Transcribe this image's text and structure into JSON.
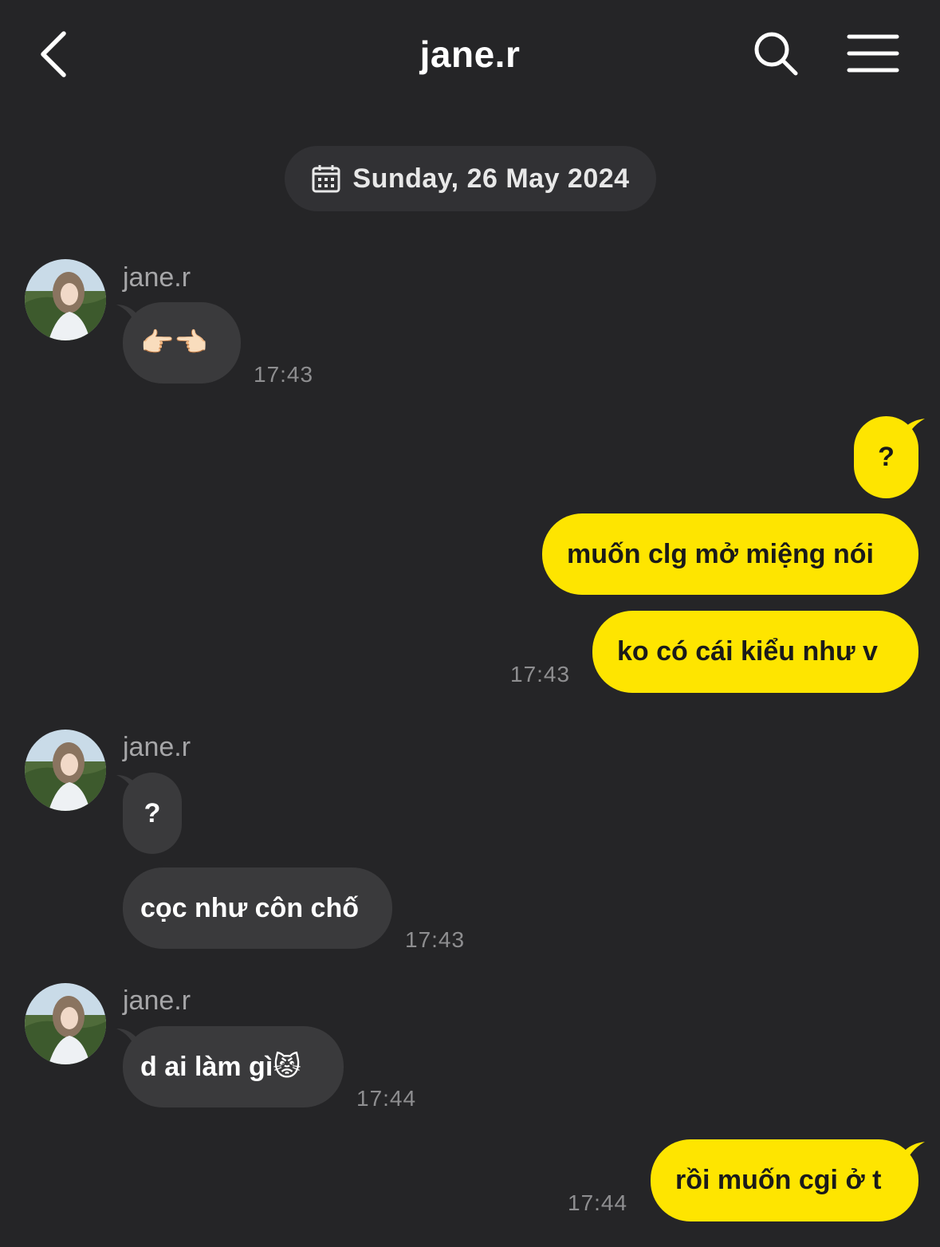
{
  "header": {
    "title": "jane.r",
    "back_icon": "chevron-left-icon",
    "search_icon": "search-icon",
    "menu_icon": "hamburger-menu-icon"
  },
  "date_divider": {
    "icon": "calendar-icon",
    "text": "Sunday, 26 May 2024"
  },
  "colors": {
    "background": "#252527",
    "incoming_bubble": "#3a3a3c",
    "outgoing_bubble": "#fee500",
    "timestamp": "#8e8e90"
  },
  "messages": [
    {
      "direction": "incoming",
      "sender": "jane.r",
      "bubbles": [
        "👉🏻👈🏻"
      ],
      "time": "17:43"
    },
    {
      "direction": "outgoing",
      "bubbles": [
        "?",
        "muốn clg mở miệng nói",
        "ko có cái kiểu như v"
      ],
      "time": "17:43"
    },
    {
      "direction": "incoming",
      "sender": "jane.r",
      "bubbles": [
        "?",
        "cọc như côn chố"
      ],
      "time": "17:43"
    },
    {
      "direction": "incoming",
      "sender": "jane.r",
      "bubbles": [
        "d ai làm gì😾"
      ],
      "time": "17:44"
    },
    {
      "direction": "outgoing",
      "bubbles": [
        "rồi muốn cgi ở t"
      ],
      "time": "17:44"
    }
  ]
}
